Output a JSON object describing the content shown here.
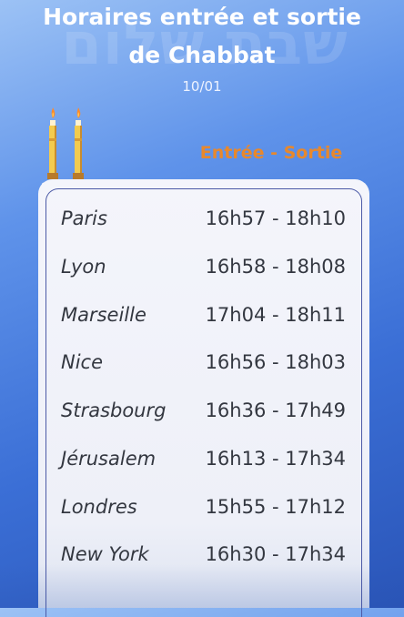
{
  "header": {
    "watermark_text": "שבת שלום",
    "title_line1": "Horaires entrée et sortie",
    "title_line2": "de Chabbat",
    "date": "10/01"
  },
  "icons": {
    "candles": "shabbat-candles-icon"
  },
  "table": {
    "column_header": "Entrée - Sortie",
    "rows": [
      {
        "city": "Paris",
        "times": "16h57 - 18h10"
      },
      {
        "city": "Lyon",
        "times": "16h58 - 18h08"
      },
      {
        "city": "Marseille",
        "times": "17h04 - 18h11"
      },
      {
        "city": "Nice",
        "times": "16h56 - 18h03"
      },
      {
        "city": "Strasbourg",
        "times": "16h36 - 17h49"
      },
      {
        "city": "Jérusalem",
        "times": "16h13 - 17h34"
      },
      {
        "city": "Londres",
        "times": "15h55 - 17h12"
      },
      {
        "city": "New York",
        "times": "16h30 - 17h34"
      }
    ]
  },
  "colors": {
    "background_top": "#9cc2f5",
    "background_bottom": "#2a55b8",
    "accent_orange": "#e8882c",
    "card": "#f4f5fb",
    "card_border": "#4c5aa6"
  }
}
